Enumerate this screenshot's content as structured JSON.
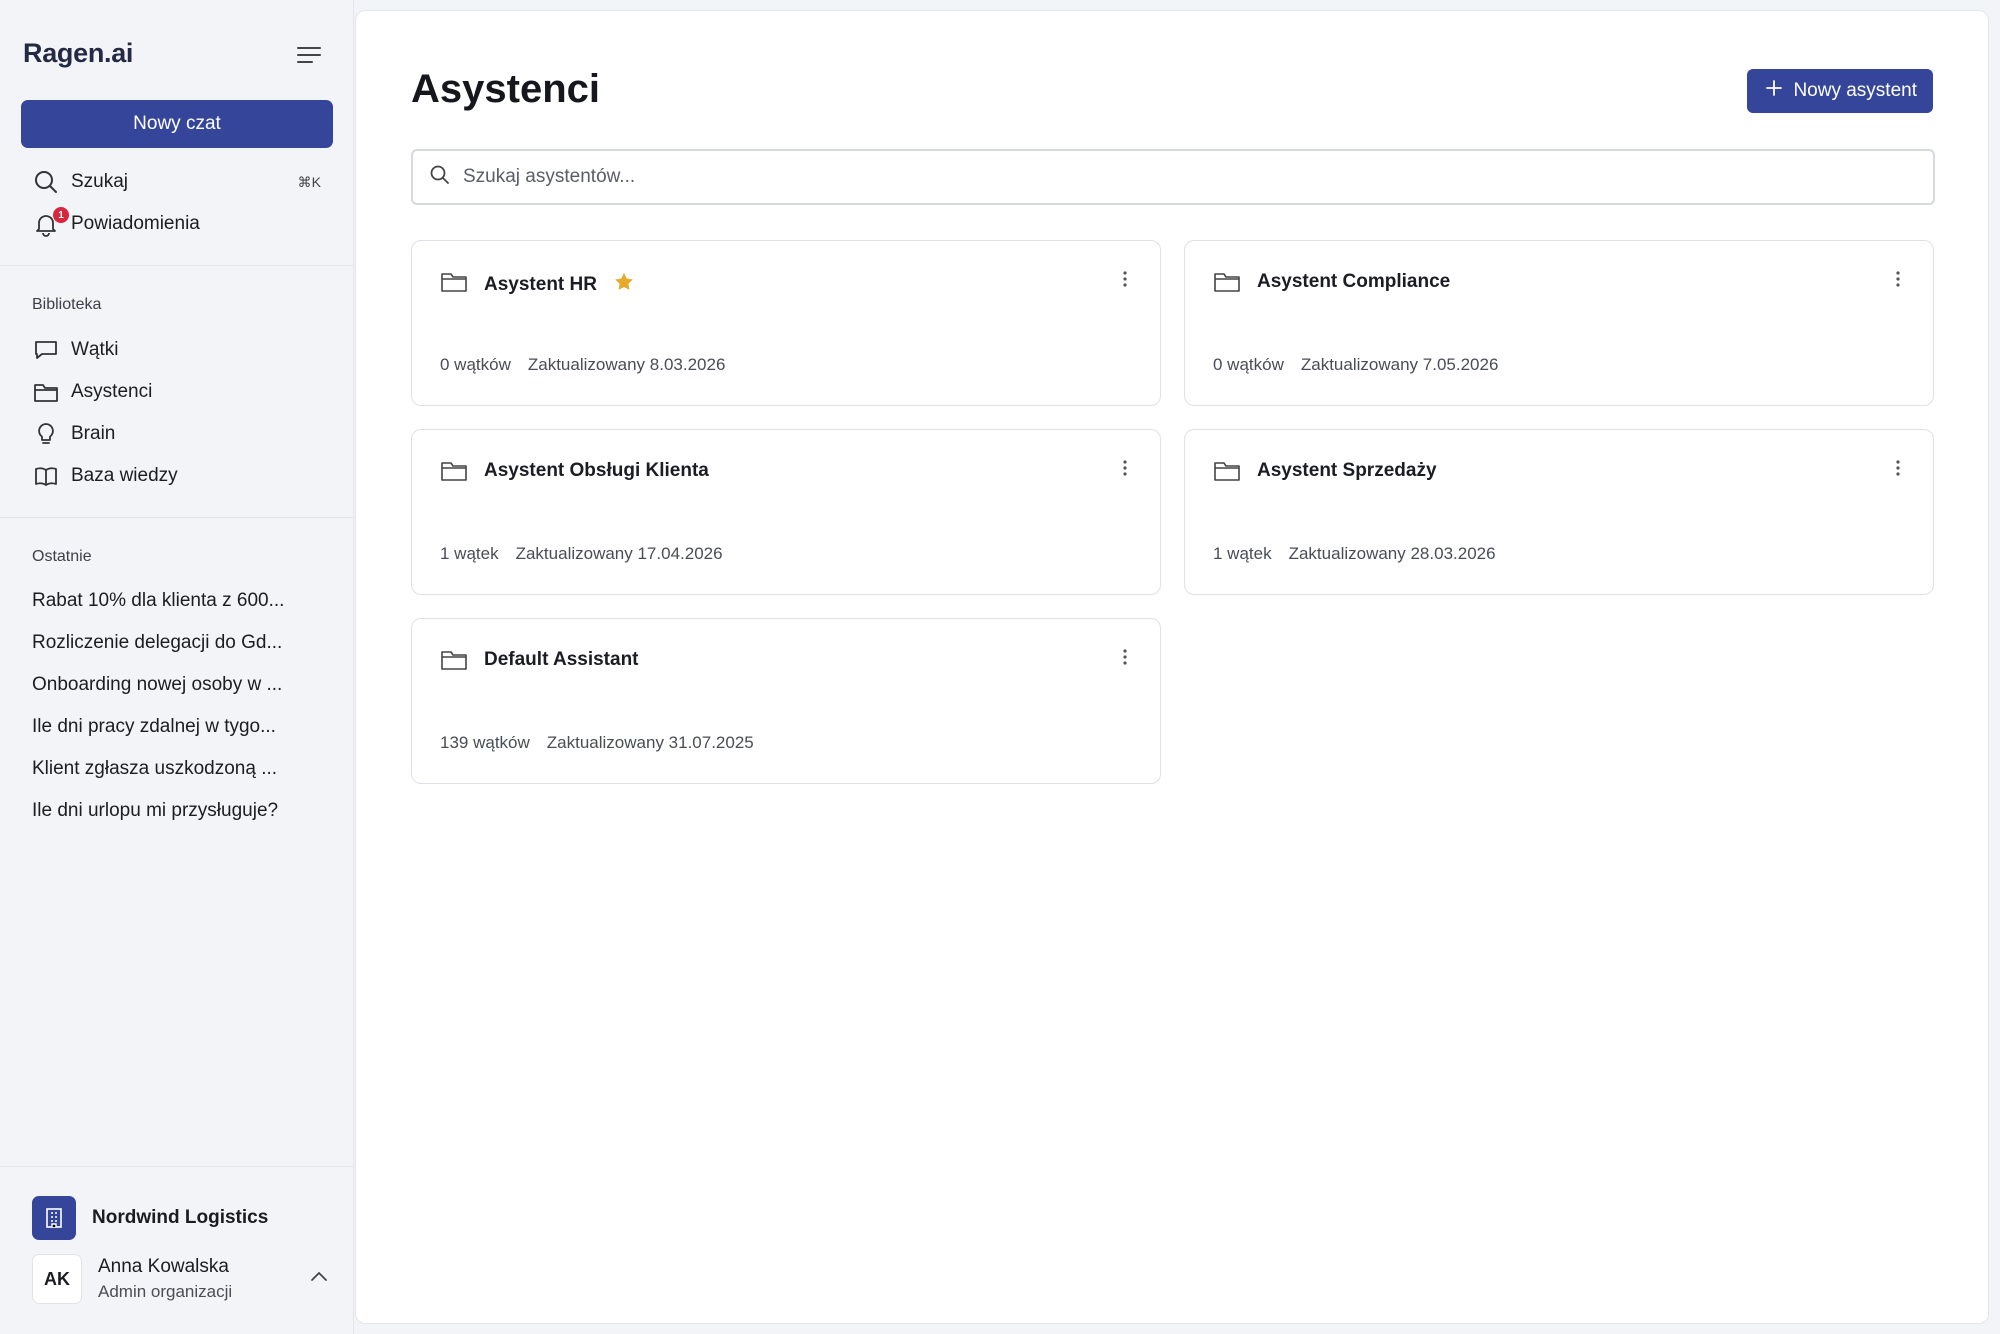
{
  "app": {
    "logo": "Ragen.ai"
  },
  "sidebar": {
    "new_chat_label": "Nowy czat",
    "search": {
      "label": "Szukaj",
      "shortcut": "⌘K"
    },
    "notifications": {
      "label": "Powiadomienia",
      "badge": "1"
    },
    "library_title": "Biblioteka",
    "library_items": [
      {
        "label": "Wątki",
        "icon": "chat-bubble-icon"
      },
      {
        "label": "Asystenci",
        "icon": "folder-icon"
      },
      {
        "label": "Brain",
        "icon": "lightbulb-icon"
      },
      {
        "label": "Baza wiedzy",
        "icon": "book-icon"
      }
    ],
    "recent_title": "Ostatnie",
    "recent_items": [
      "Rabat 10% dla klienta z 600...",
      "Rozliczenie delegacji do Gd...",
      "Onboarding nowej osoby w ...",
      "Ile dni pracy zdalnej w tygo...",
      "Klient zgłasza uszkodzoną ...",
      "Ile dni urlopu mi przysługuje?"
    ],
    "organization": {
      "name": "Nordwind Logistics",
      "icon": "building-icon"
    },
    "user": {
      "initials": "AK",
      "name": "Anna Kowalska",
      "role": "Admin organizacji"
    }
  },
  "main": {
    "title": "Asystenci",
    "new_button_label": "Nowy asystent",
    "search_placeholder": "Szukaj asystentów...",
    "assistants": [
      {
        "name": "Asystent HR",
        "starred": true,
        "threads": "0 wątków",
        "updated": "Zaktualizowany 8.03.2026"
      },
      {
        "name": "Asystent Compliance",
        "starred": false,
        "threads": "0 wątków",
        "updated": "Zaktualizowany 7.05.2026"
      },
      {
        "name": "Asystent Obsługi Klienta",
        "starred": false,
        "threads": "1 wątek",
        "updated": "Zaktualizowany 17.04.2026"
      },
      {
        "name": "Asystent Sprzedaży",
        "starred": false,
        "threads": "1 wątek",
        "updated": "Zaktualizowany 28.03.2026"
      },
      {
        "name": "Default Assistant",
        "starred": false,
        "threads": "139 wątków",
        "updated": "Zaktualizowany 31.07.2025"
      }
    ]
  },
  "colors": {
    "accent": "#35469a",
    "star": "#e8a92a",
    "badge": "#d7263d"
  }
}
